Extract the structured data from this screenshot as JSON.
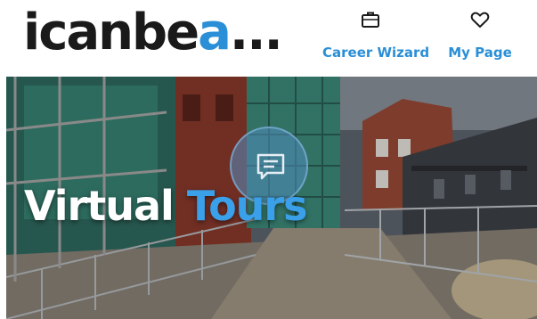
{
  "logo": {
    "text_main": "icanbe",
    "text_accent": "a",
    "text_dots": "..."
  },
  "nav": {
    "items": [
      {
        "label": "Career Wizard",
        "icon": "briefcase-icon"
      },
      {
        "label": "My Page",
        "icon": "heart-icon"
      }
    ]
  },
  "hero": {
    "title_part1": "Virtual",
    "title_part2": "Tours",
    "icon": "chat-icon"
  },
  "colors": {
    "accent": "#2a8fd6",
    "logo_dark": "#1a1a1a",
    "title_white": "#ffffff",
    "title_blue": "#3aa0ea"
  }
}
